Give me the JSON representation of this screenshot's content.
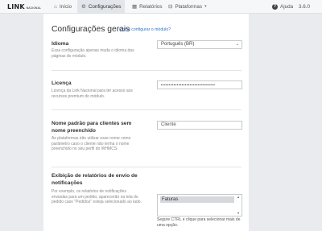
{
  "navbar": {
    "logo_main": "LINK",
    "logo_sub": "NACIONAL",
    "items": [
      {
        "label": "Início",
        "icon": "home-icon"
      },
      {
        "label": "Configurações",
        "icon": "gear-icon"
      },
      {
        "label": "Relatórios",
        "icon": "table-icon"
      },
      {
        "label": "Plataformas",
        "icon": "box-icon"
      }
    ],
    "help_label": "Ajuda",
    "version": "3.6.0"
  },
  "page": {
    "title": "Configurações gerais",
    "help_link": "Como configurar o módulo?"
  },
  "settings": {
    "language": {
      "label": "Idioma",
      "description": "Essa configuração apenas muda o idioma das páginas do módulo.",
      "value": "Português (BR)"
    },
    "license": {
      "label": "Licença",
      "description": "Licença da Link Nacional para ter acesso aos recursos premium do módulo.",
      "value": "••••••••••••••••••••••••••••••••••"
    },
    "default_name": {
      "label": "Nome padrão para clientes sem nome preenchido",
      "description": "As plataformas irão utilizar esse nome como parâmetro caso o cliente não tenha o nome preenchido no seu perfil do WHMCS.",
      "value": "Cliente"
    },
    "reports": {
      "label": "Exibição de relatórios de envio de notificações",
      "description": "Por exemplo, os relatórios de notificações enviadas para um pedido, aparecerão na tela do pedido caso \"Pedidos\" esteja selecionado ao lado.",
      "options": [
        "Faturas"
      ],
      "hint": "Segure CTRL e clique para selecionar mais de uma opção."
    }
  },
  "colors": {
    "accent": "#2a72c9",
    "logo_accent": "#1f9cd8",
    "background": "#e9ebee"
  }
}
